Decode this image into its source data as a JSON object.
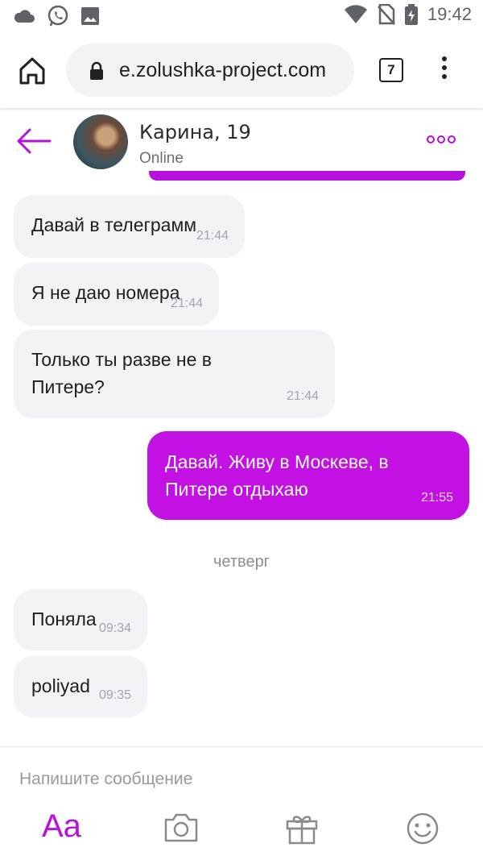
{
  "status_bar": {
    "time": "19:42",
    "icons": [
      "cloud-icon",
      "whatsapp-icon",
      "image-icon",
      "wifi-icon",
      "no-sim-icon",
      "battery-icon"
    ]
  },
  "browser": {
    "url": "e.zolushka-project.com",
    "tab_count": "7",
    "icons": [
      "home-icon",
      "lock-icon",
      "menu-dots-icon"
    ]
  },
  "chat_header": {
    "name": "Карина, 19",
    "status": "Online",
    "accent": "#b711dd"
  },
  "messages": [
    {
      "direction": "in",
      "text": "Давай в телеграмм",
      "time": "21:44"
    },
    {
      "direction": "in",
      "text": "Я не даю номера",
      "time": "21:44"
    },
    {
      "direction": "in",
      "text": "Только ты разве не в Питере?",
      "time": "21:44"
    },
    {
      "direction": "out",
      "text": "Давай. Живу в Москеве, в Питере отдыхаю",
      "time": "21:55"
    },
    {
      "direction": "in",
      "text": "Поняла",
      "time": "09:34"
    },
    {
      "direction": "in",
      "text": "poliyad",
      "time": "09:35"
    }
  ],
  "day_separator": "четверг",
  "composer": {
    "placeholder": "Напишите сообщение",
    "aa_label": "Aa",
    "tools": [
      "camera-icon",
      "gift-icon",
      "emoji-icon"
    ]
  }
}
